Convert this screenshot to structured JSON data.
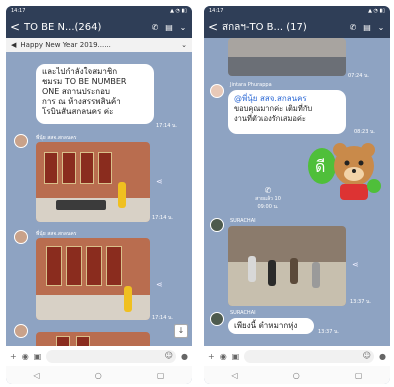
{
  "left": {
    "status": {
      "time": "14:17",
      "icons": "▲ ◔ ▮▯"
    },
    "header": {
      "back": "<",
      "title": "TO BE N...(264)",
      "call_icon": "✆",
      "note_icon": "▤",
      "menu_icon": "⌄"
    },
    "announcement": {
      "icon": "speaker",
      "text": "Happy New Year 2019......",
      "chevron": "⌄"
    },
    "messages": [
      {
        "type": "text",
        "text": "และไปกำลังใจสมาชิก\nชมรม TO BE NUMBER\nONE สถานประกอบ\nการ ณ ห้างสรรพสินค้า\nโรบินสันสกลนคร ค่ะ",
        "time": "17:14 น."
      },
      {
        "type": "image",
        "sender": "พี่นุ้ย สสจ.สกลนคร",
        "time": "17:14 น."
      },
      {
        "type": "image",
        "sender": "พี่นุ้ย สสจ.สกลนคร",
        "time": "17:14 น."
      }
    ],
    "scroll_icon": "↓"
  },
  "right": {
    "status": {
      "time": "14:17",
      "icons": "▲ ◔ ▮▯"
    },
    "header": {
      "back": "<",
      "title": "สกลฯ-TO B... (17)",
      "call_icon": "✆",
      "note_icon": "▤",
      "menu_icon": "⌄"
    },
    "messages": [
      {
        "type": "image_top",
        "time": "07:24 น."
      },
      {
        "type": "text",
        "sender": "Jintara Phurappa",
        "mention": "@พี่นุ้ย สสจ.สกลนคร",
        "text": "ขอบคุณมากค่ะ เติมที่กับ\nงานที่ตัวเองรักเสมอค่ะ",
        "time": "08:23 น."
      },
      {
        "type": "sticker"
      },
      {
        "type": "call",
        "label": "สายแล้ว 10",
        "duration": "09:00 น."
      },
      {
        "type": "image",
        "sender": "SURACHAI",
        "time": "13:37 น."
      },
      {
        "type": "text",
        "sender": "SURACHAI",
        "text": "เพียงนี้ ตำหมากหุ่ง",
        "time": "13:37 น."
      }
    ]
  },
  "input": {
    "plus": "+",
    "camera": "◉",
    "image": "▣",
    "emoji": "☺",
    "mic": "🎤"
  },
  "nav": {
    "back": "◁",
    "home": "○",
    "recent": "▢"
  }
}
